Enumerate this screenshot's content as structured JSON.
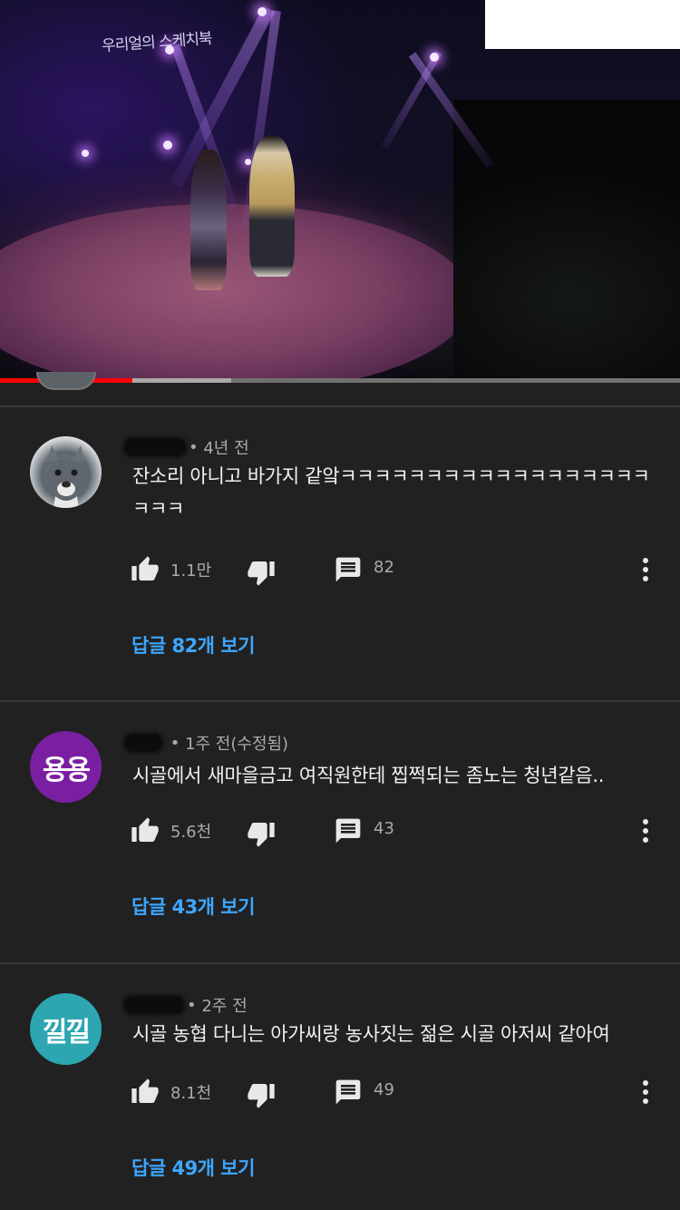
{
  "video": {
    "logo_text": "우리얼의 스케치북",
    "progress_fraction": 0.195,
    "buffered_fraction": 0.34
  },
  "comments": [
    {
      "time": "4년 전",
      "text": "잔소리 아니고 바가지 같앜ㅋㅋㅋㅋㅋㅋㅋㅋㅋㅋㅋㅋㅋㅋㅋㅋㅋㅋㅋㅋㅋ",
      "likes": "1.1만",
      "reply_count": "82",
      "replies_label": "답글 82개 보기",
      "avatar": {
        "type": "photo",
        "icon": "dog-photo-avatar"
      }
    },
    {
      "time": "1주 전(수정됨)",
      "text": "시골에서 새마을금고 여직원한테 찝쩍되는 좀노는 청년같음..",
      "likes": "5.6천",
      "reply_count": "43",
      "replies_label": "답글 43개 보기",
      "avatar": {
        "type": "initials",
        "initials": "용용",
        "color": "#7b1fa2"
      }
    },
    {
      "time": "2주 전",
      "text": "시골 농협 다니는 아가씨랑 농사짓는 젊은 시골 아저씨 같아여",
      "likes": "8.1천",
      "reply_count": "49",
      "replies_label": "답글 49개 보기",
      "avatar": {
        "type": "initials",
        "initials": "낄낄",
        "color": "#2da6b2"
      }
    }
  ],
  "icons": {
    "like": "thumbs-up-icon",
    "dislike": "thumbs-down-icon",
    "reply": "comment-icon",
    "more": "more-vert-icon"
  },
  "colors": {
    "background": "#212121",
    "link": "#3ea6ff",
    "progress": "#ff0000",
    "meta": "#aaaaaa"
  }
}
